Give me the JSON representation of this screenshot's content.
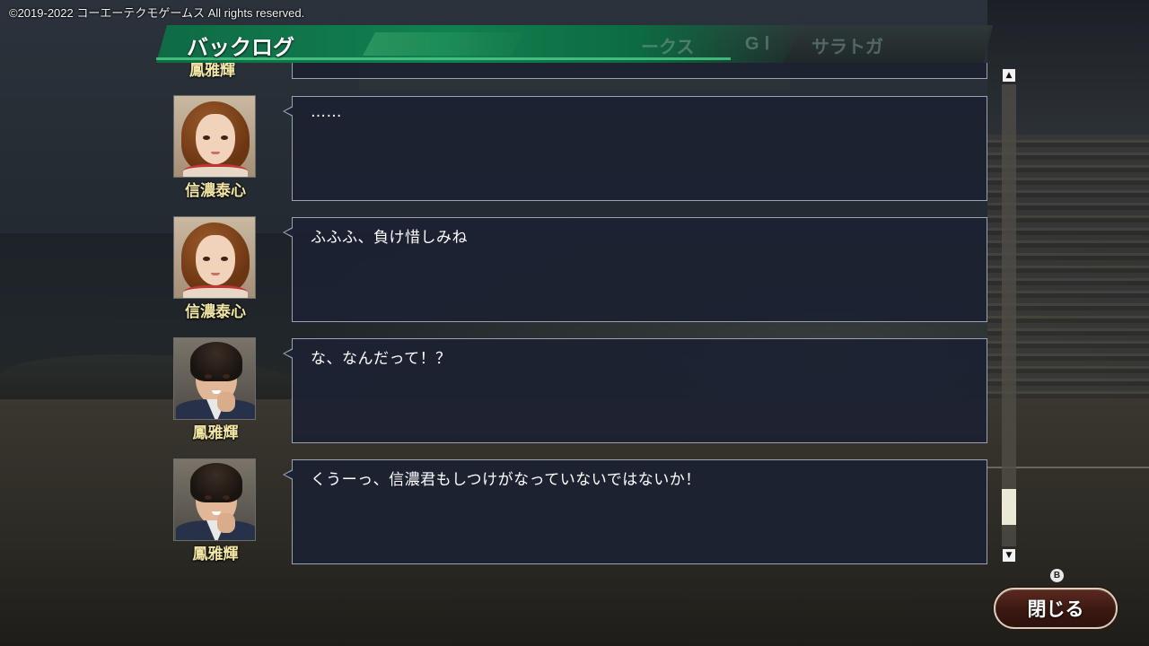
{
  "copyright": "©2019-2022 コーエーテクモゲームス All rights reserved.",
  "header": {
    "title": "バックログ",
    "ghost_texts": [
      "ークス",
      "GⅠ",
      "サラトガ"
    ]
  },
  "log": {
    "cut_off_speaker": "鳳雅輝",
    "entries": [
      {
        "speaker": "信濃泰心",
        "text": "……",
        "portrait": "female-portrait"
      },
      {
        "speaker": "信濃泰心",
        "text": "ふふふ、負け惜しみね",
        "portrait": "female-portrait"
      },
      {
        "speaker": "鳳雅輝",
        "text": "な、なんだって！？",
        "portrait": "male-portrait"
      },
      {
        "speaker": "鳳雅輝",
        "text": "くうーっ、信濃君もしつけがなっていないではないか！",
        "portrait": "male-portrait"
      }
    ]
  },
  "scrollbar": {
    "up_icon": "arrow-up-icon",
    "down_icon": "arrow-down-icon",
    "position": 0.95
  },
  "close": {
    "hint": "B",
    "label": "閉じる"
  },
  "colors": {
    "accent_green": "#11804f",
    "speaker_name": "#f3e7a6",
    "bubble_bg": "#1c2232"
  }
}
